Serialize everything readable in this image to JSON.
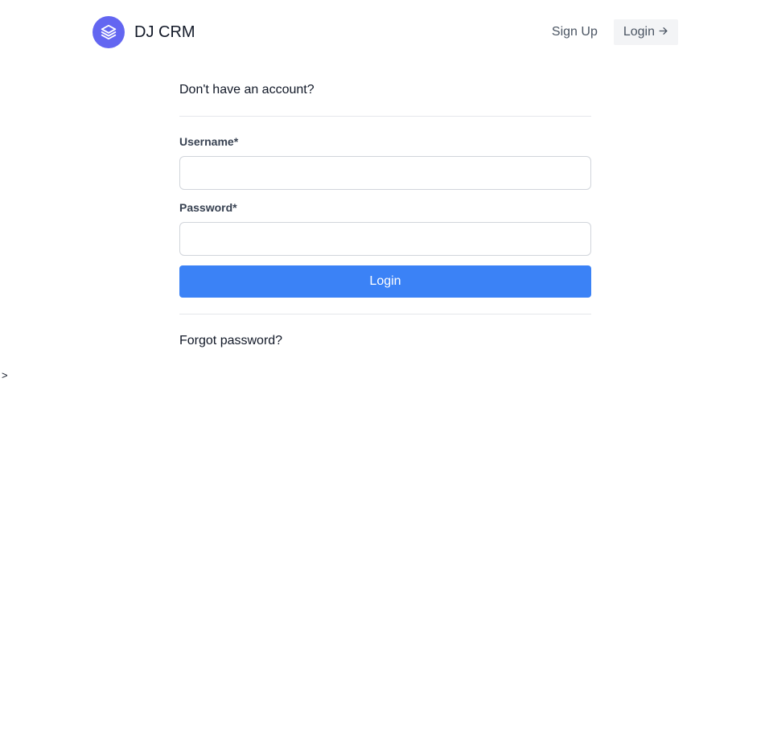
{
  "header": {
    "brand_name": "DJ CRM",
    "logo_icon": "layers-icon",
    "nav": {
      "signup_label": "Sign Up",
      "login_label": "Login",
      "login_icon": "arrow-right-icon"
    }
  },
  "form": {
    "signup_prompt": "Don't have an account?",
    "username_label": "Username*",
    "username_value": "",
    "password_label": "Password*",
    "password_value": "",
    "submit_label": "Login",
    "forgot_label": "Forgot password?"
  },
  "stray_text": ">",
  "colors": {
    "brand": "#6366f1",
    "primary_button": "#3b82f6",
    "nav_button_bg": "#f3f4f6"
  }
}
